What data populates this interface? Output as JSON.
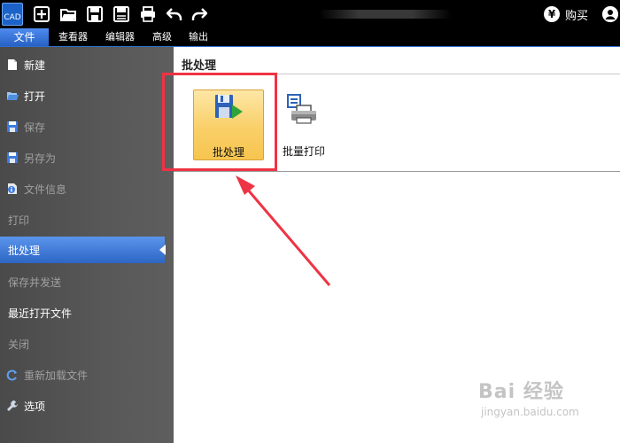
{
  "app": {
    "logo_text": "CAD"
  },
  "titlebar": {
    "quick_access_icons": [
      "new-icon",
      "open-folder-icon",
      "save-icon",
      "save-as-icon",
      "print-icon",
      "undo-icon",
      "redo-icon"
    ],
    "buy_symbol": "¥",
    "buy_label": "购买"
  },
  "menubar": {
    "items": [
      {
        "label": "文件",
        "active": true
      },
      {
        "label": "查看器"
      },
      {
        "label": "编辑器"
      },
      {
        "label": "高级"
      },
      {
        "label": "输出"
      }
    ]
  },
  "sidebar": {
    "items": [
      {
        "label": "新建",
        "icon": "new-document-icon",
        "enabled": true
      },
      {
        "label": "打开",
        "icon": "open-folder-icon",
        "enabled": true
      },
      {
        "label": "保存",
        "icon": "save-icon",
        "enabled": false
      },
      {
        "label": "另存为",
        "icon": "save-as-icon",
        "enabled": false
      },
      {
        "label": "文件信息",
        "icon": "file-info-icon",
        "enabled": false
      },
      {
        "label": "打印",
        "enabled": false
      },
      {
        "label": "批处理",
        "enabled": true,
        "selected": true
      },
      {
        "label": "保存并发送",
        "enabled": false
      },
      {
        "label": "最近打开文件",
        "enabled": true
      },
      {
        "label": "关闭",
        "enabled": false
      },
      {
        "label": "重新加载文件",
        "icon": "reload-icon",
        "enabled": false
      },
      {
        "label": "选项",
        "icon": "wrench-icon",
        "enabled": true
      }
    ]
  },
  "content": {
    "title": "批处理",
    "tools": [
      {
        "label": "批处理",
        "icon": "batch-process-icon"
      },
      {
        "label": "批量打印",
        "icon": "batch-print-icon"
      }
    ]
  },
  "watermark": {
    "main": "Bai 经验",
    "url": "jingyan.baidu.com"
  },
  "colors": {
    "accent": "#2f6fd6",
    "highlight": "#ee3344",
    "selected_tool": "#f9cf68"
  }
}
